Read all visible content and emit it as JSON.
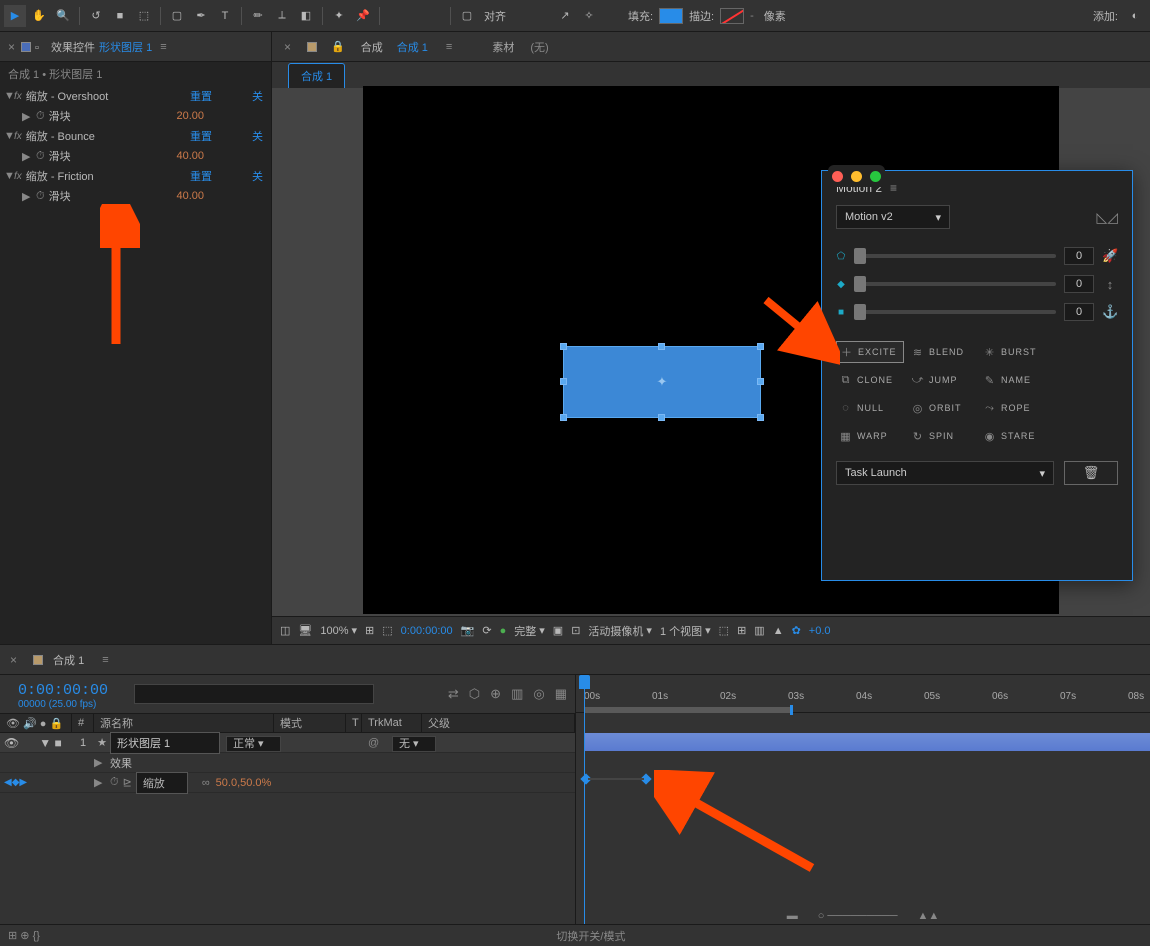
{
  "toolbar": {
    "align": "对齐",
    "fill": "填充:",
    "stroke": "描边:",
    "stroke_px": "像素",
    "add": "添加:"
  },
  "effects_panel": {
    "tab_prefix": "效果控件",
    "tab_link": "形状图层 1",
    "breadcrumb": "合成 1 • 形状图层 1",
    "effects": [
      {
        "name": "缩放 - Overshoot",
        "reset": "重置",
        "close": "关",
        "prop": "滑块",
        "value": "20.00"
      },
      {
        "name": "缩放 - Bounce",
        "reset": "重置",
        "close": "关",
        "prop": "滑块",
        "value": "40.00"
      },
      {
        "name": "缩放 - Friction",
        "reset": "重置",
        "close": "关",
        "prop": "滑块",
        "value": "40.00"
      }
    ]
  },
  "comp_panel": {
    "tab_prefix": "合成",
    "tab_link": "合成 1",
    "panel_res": "素材",
    "panel_none": "(无)",
    "active_tab": "合成 1"
  },
  "viewport": {
    "zoom": "100%",
    "time": "0:00:00:00",
    "quality": "完整",
    "camera": "活动摄像机",
    "views": "1 个视图",
    "exposure": "+0.0"
  },
  "motion": {
    "title": "Motion 2",
    "dropdown": "Motion v2",
    "slider_values": [
      "0",
      "0",
      "0"
    ],
    "buttons": [
      {
        "icon": "＋",
        "label": "EXCITE",
        "hl": true
      },
      {
        "icon": "≋",
        "label": "BLEND"
      },
      {
        "icon": "✳",
        "label": "BURST"
      },
      {
        "icon": "⧉",
        "label": "CLONE"
      },
      {
        "icon": "⤻",
        "label": "JUMP"
      },
      {
        "icon": "✎",
        "label": "NAME"
      },
      {
        "icon": "◌",
        "label": "NULL"
      },
      {
        "icon": "◎",
        "label": "ORBIT"
      },
      {
        "icon": "⤳",
        "label": "ROPE"
      },
      {
        "icon": "▦",
        "label": "WARP"
      },
      {
        "icon": "↻",
        "label": "SPIN"
      },
      {
        "icon": "◉",
        "label": "STARE"
      }
    ],
    "task": "Task Launch"
  },
  "timeline": {
    "tab": "合成 1",
    "timecode": "0:00:00:00",
    "fps": "00000 (25.00 fps)",
    "cols": {
      "source": "源名称",
      "mode": "模式",
      "t": "T",
      "trkmat": "TrkMat",
      "parent": "父级"
    },
    "layer": {
      "index": "1",
      "name": "形状图层 1",
      "mode": "正常",
      "parent": "无"
    },
    "effects_label": "效果",
    "scale_label": "缩放",
    "scale_value": "50.0,50.0%",
    "ticks": [
      "00s",
      "01s",
      "02s",
      "03s",
      "04s",
      "05s",
      "06s",
      "07s",
      "08s"
    ],
    "toggle_label": "切换开关/模式"
  }
}
